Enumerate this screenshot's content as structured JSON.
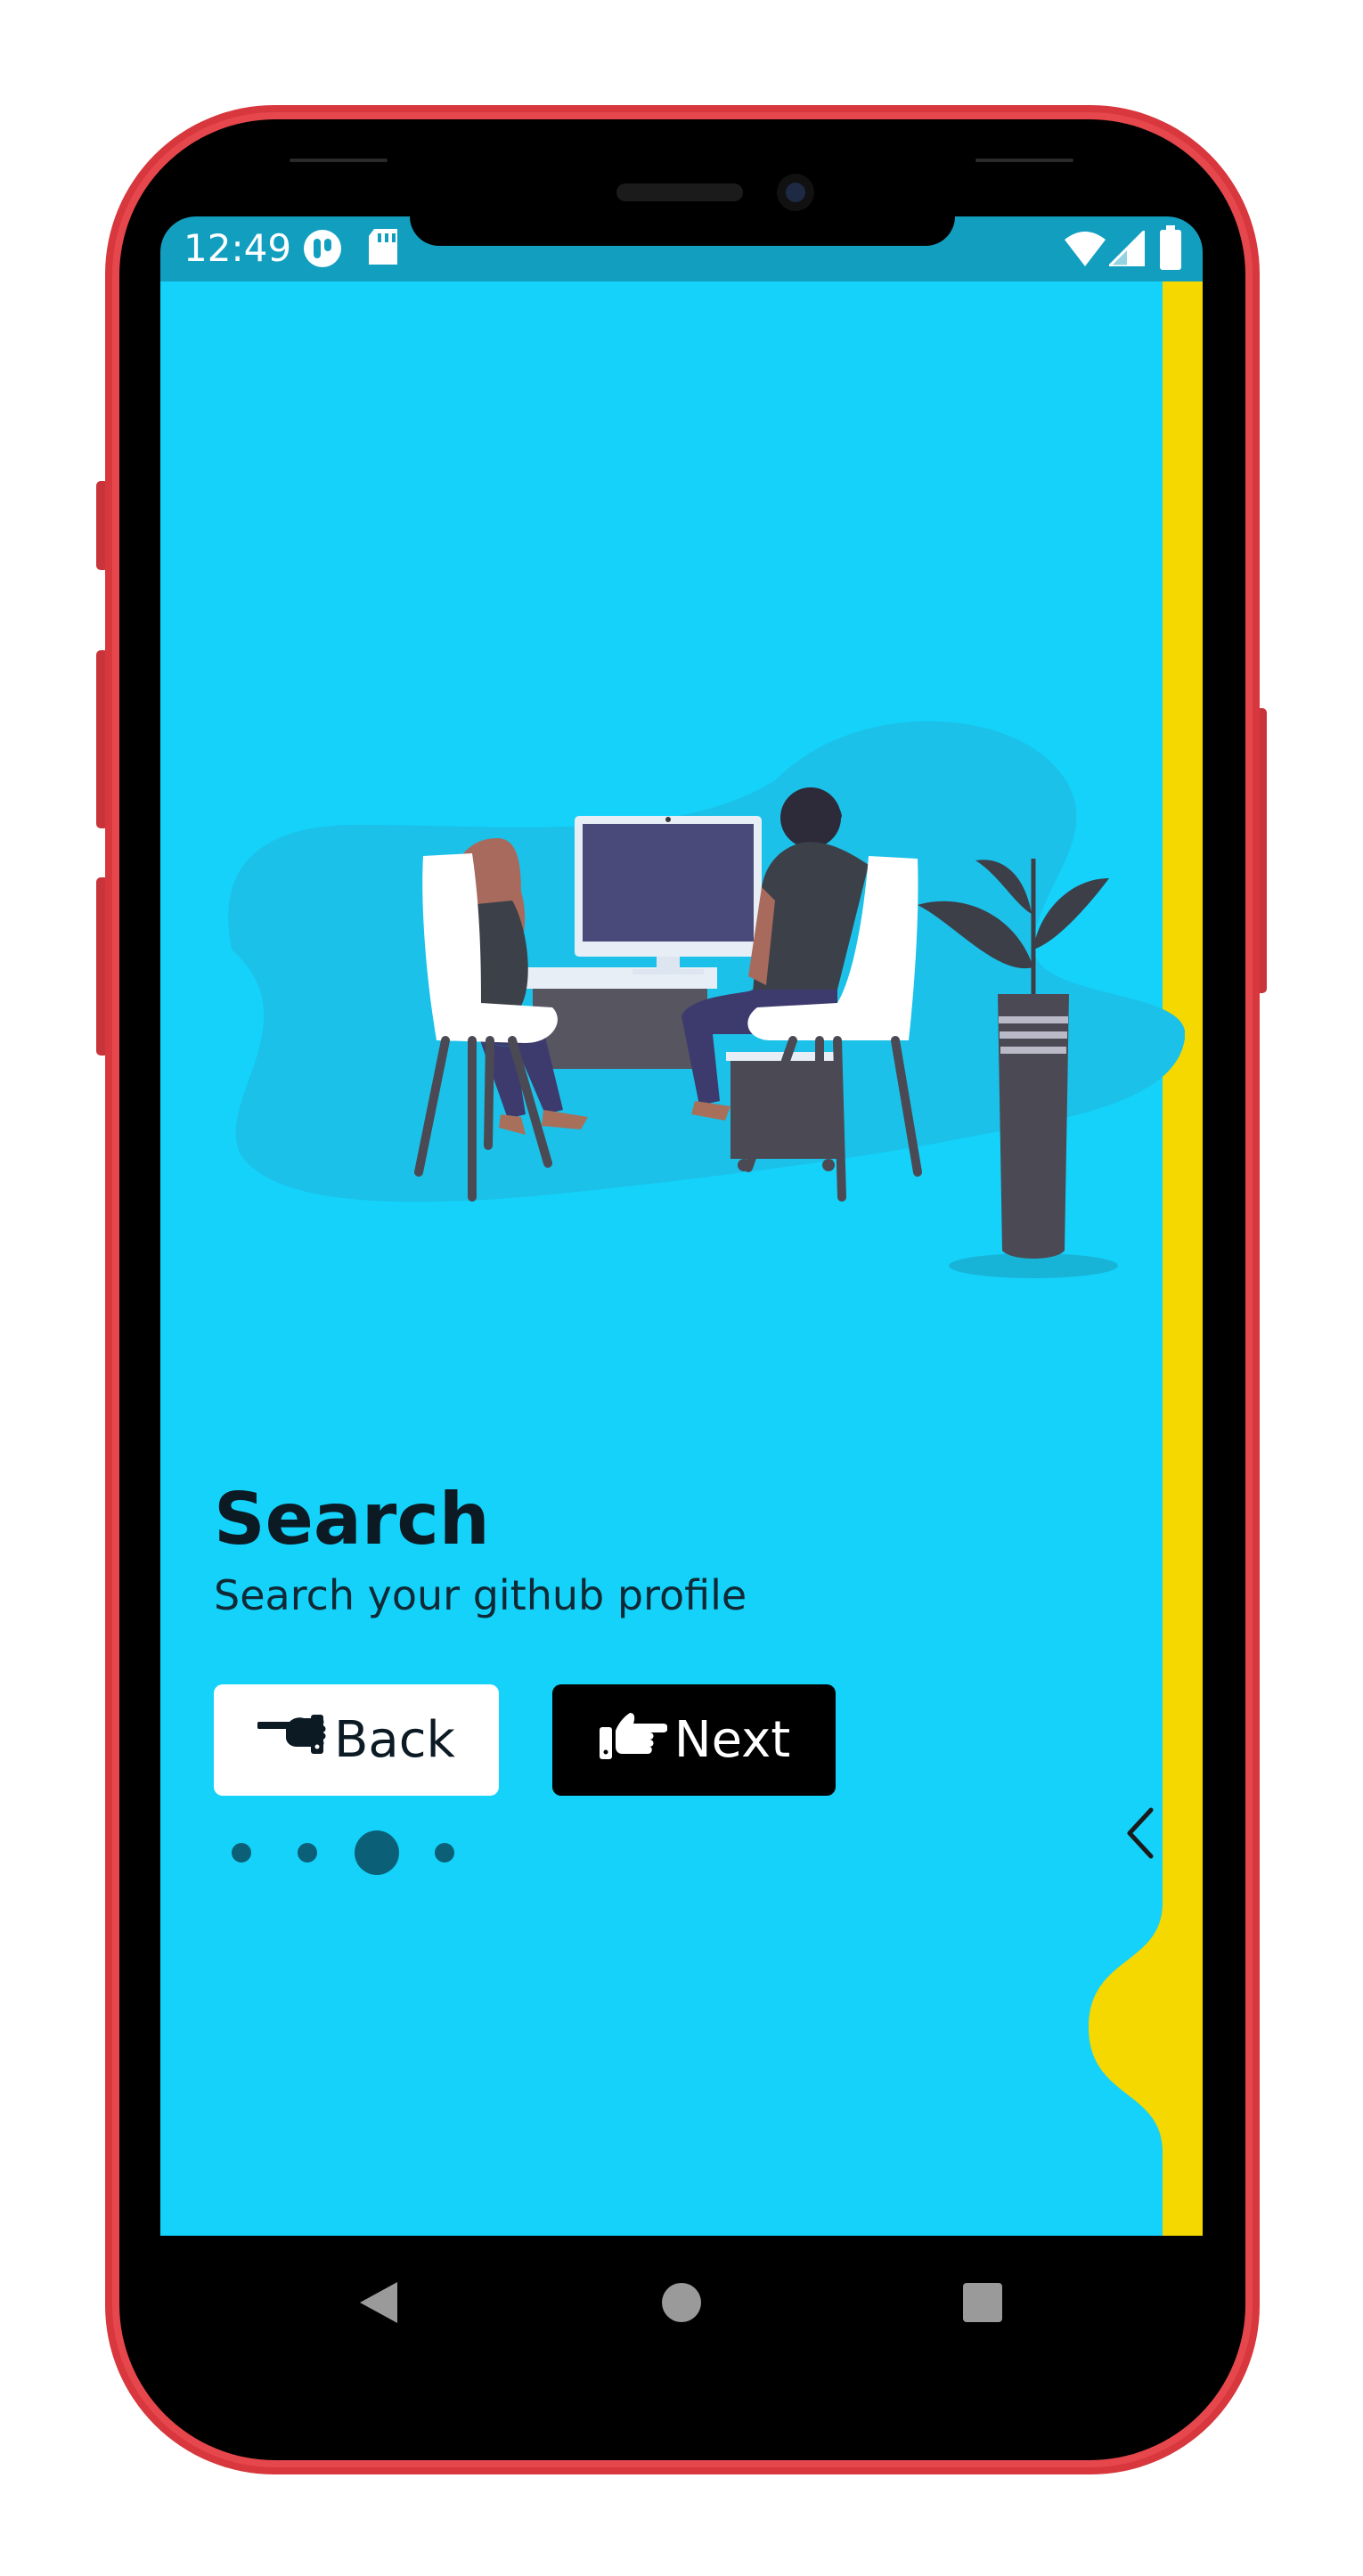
{
  "status_bar": {
    "time": "12:49",
    "left_icons": [
      "app-notification-icon",
      "sd-card-icon"
    ],
    "right_icons": [
      "wifi-icon",
      "cell-signal-icon",
      "battery-icon"
    ]
  },
  "onboarding": {
    "title": "Search",
    "subtitle": "Search your github profile",
    "back_label": "Back",
    "next_label": "Next",
    "back_icon": "hand-pointing-left-icon",
    "next_icon": "hand-pointing-right-icon",
    "page_count": 4,
    "active_page": 3
  },
  "swipe_handle_icon": "chevron-left-icon",
  "nav_bar": {
    "icons": [
      "back-triangle-icon",
      "home-circle-icon",
      "recents-square-icon"
    ]
  },
  "colors": {
    "screen_bg": "#14d2fa",
    "status_bar_bg": "#129fbf",
    "liquid_edge": "#f5d800",
    "phone_frame": "#d9363e",
    "dot_color": "#0b6077"
  }
}
